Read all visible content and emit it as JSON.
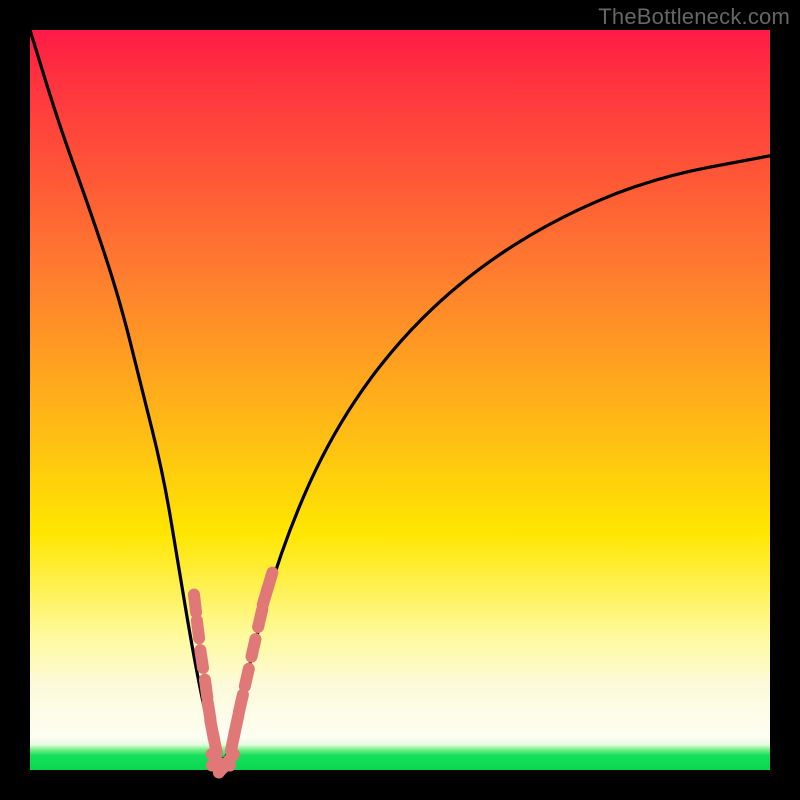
{
  "watermark": {
    "text": "TheBottleneck.com"
  },
  "chart_data": {
    "type": "line",
    "title": "",
    "xlabel": "",
    "ylabel": "",
    "xlim": [
      0,
      100
    ],
    "ylim": [
      0,
      100
    ],
    "grid": false,
    "legend": false,
    "background_gradient": {
      "direction": "vertical",
      "stops": [
        {
          "pos": 0,
          "color": "#ff1a46"
        },
        {
          "pos": 18,
          "color": "#ff5238"
        },
        {
          "pos": 45,
          "color": "#ffa020"
        },
        {
          "pos": 68,
          "color": "#ffe600"
        },
        {
          "pos": 88,
          "color": "#fcfada"
        },
        {
          "pos": 97,
          "color": "#7ef08c"
        },
        {
          "pos": 100,
          "color": "#08d84e"
        }
      ]
    },
    "series": [
      {
        "name": "bottleneck-curve",
        "color": "#000000",
        "x": [
          0,
          4,
          8,
          12,
          15,
          18,
          20,
          22,
          24,
          26,
          28,
          30,
          34,
          40,
          48,
          58,
          70,
          84,
          100
        ],
        "y": [
          100,
          87,
          76,
          64,
          52,
          40,
          28,
          16,
          6,
          0,
          6,
          16,
          30,
          44,
          56,
          66,
          74,
          80,
          83
        ]
      },
      {
        "name": "data-points-left",
        "color": "#e07878",
        "type": "scatter",
        "x": [
          22.3,
          22.7,
          23.2,
          23.8,
          24.2,
          24.6,
          25.0
        ],
        "y": [
          22.5,
          19.0,
          15.0,
          11.0,
          8.0,
          5.5,
          3.5
        ]
      },
      {
        "name": "data-points-right",
        "color": "#e07878",
        "type": "scatter",
        "x": [
          27.4,
          27.9,
          28.5,
          29.3,
          30.2,
          31.1,
          31.8,
          32.4
        ],
        "y": [
          3.8,
          6.2,
          9.0,
          12.5,
          16.5,
          20.5,
          23.5,
          25.5
        ]
      },
      {
        "name": "data-points-bottom",
        "color": "#e07878",
        "type": "scatter",
        "x": [
          25.3,
          25.8,
          26.3,
          26.8
        ],
        "y": [
          1.2,
          0.6,
          0.6,
          1.2
        ]
      }
    ]
  }
}
